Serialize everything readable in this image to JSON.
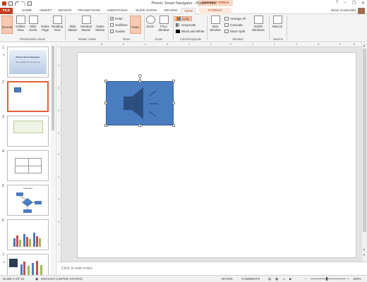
{
  "window": {
    "title": "Phonic Smart Navigator - PowerPoint",
    "contextual_group": "DRAWING TOOLS",
    "controls": [
      "?",
      "–",
      "❐",
      "✕"
    ],
    "user": "Brian Underdahl"
  },
  "tabs": [
    {
      "label": "FILE"
    },
    {
      "label": "HOME"
    },
    {
      "label": "INSERT"
    },
    {
      "label": "DESIGN"
    },
    {
      "label": "TRANSITIONS"
    },
    {
      "label": "ANIMATIONS"
    },
    {
      "label": "SLIDE SHOW"
    },
    {
      "label": "REVIEW"
    },
    {
      "label": "VIEW"
    },
    {
      "label": "FORMAT"
    }
  ],
  "ribbon": {
    "presentation_views": {
      "label": "Presentation Views",
      "buttons": [
        "Normal",
        "Outline View",
        "Slide Sorter",
        "Notes Page",
        "Reading View"
      ]
    },
    "master_views": {
      "label": "Master Views",
      "buttons": [
        "Slide Master",
        "Handout Master",
        "Notes Master"
      ]
    },
    "show": {
      "label": "Show",
      "checks": [
        {
          "label": "Ruler",
          "checked": "✓"
        },
        {
          "label": "Gridlines",
          "checked": ""
        },
        {
          "label": "Guides",
          "checked": ""
        }
      ],
      "notes_button": "Notes"
    },
    "zoom": {
      "label": "Zoom",
      "buttons": [
        "Zoom",
        "Fit to Window"
      ]
    },
    "color_grayscale": {
      "label": "Color/Grayscale",
      "items": [
        "Color",
        "Grayscale",
        "Black and White"
      ]
    },
    "window": {
      "label": "Window",
      "new_window": "New Window",
      "items": [
        "Arrange All",
        "Cascade",
        "Move Split"
      ],
      "switch": "Switch Windows"
    },
    "macros": {
      "label": "Macros",
      "button": "Macros"
    }
  },
  "slides": [
    {
      "num": "1",
      "title": "Phonic Smart Navigator",
      "subtitle": "DTs, manage the tools you use"
    },
    {
      "num": "2"
    },
    {
      "num": "3"
    },
    {
      "num": "4"
    },
    {
      "num": "5",
      "title": "Logic Flow"
    },
    {
      "num": "6"
    },
    {
      "num": "7"
    }
  ],
  "notes_placeholder": "Click to add notes",
  "status": {
    "slide": "SLIDE 2 OF 22",
    "language": "ENGLISH (UNITED STATES)",
    "notes": "NOTES",
    "comments": "COMMENTS",
    "zoom": "100%"
  },
  "ruler_h": [
    "6",
    "5",
    "4",
    "3",
    "2",
    "1",
    "0",
    "1",
    "2",
    "3",
    "4",
    "5",
    "6"
  ],
  "ruler_v": [
    "4",
    "3",
    "2",
    "1",
    "0",
    "1",
    "2",
    "3",
    "4"
  ],
  "colors": {
    "accent": "#c43e1c",
    "shape": "#4a7cc0",
    "shape_dark": "#2c4f80"
  }
}
